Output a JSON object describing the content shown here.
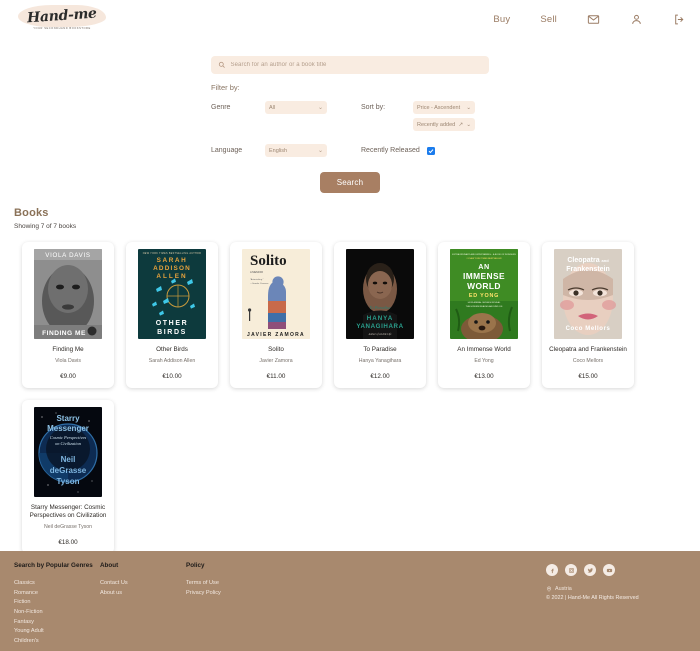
{
  "header": {
    "logo_word": "Hand-me",
    "logo_sub": "YOUR SECONDHAND BOOKSTORE",
    "nav": [
      {
        "label": "Buy",
        "name": "nav-buy"
      },
      {
        "label": "Sell",
        "name": "nav-sell"
      }
    ],
    "icons": [
      {
        "name": "mail-icon"
      },
      {
        "name": "user-icon"
      },
      {
        "name": "logout-icon"
      }
    ],
    "accent": "#9a7b63"
  },
  "search": {
    "placeholder": "Search for an author or a book title",
    "value": "",
    "icon": "search-icon"
  },
  "filters": {
    "title": "Filter by:",
    "genre_label": "Genre",
    "genre_value": "All",
    "language_label": "Language",
    "language_value": "English",
    "sort_label": "Sort by:",
    "sort_price_value": "Price - Ascendent",
    "sort_recent_value": "Recently added",
    "sort_recent_direction": "↗",
    "recently_released_label": "Recently Released",
    "recently_released_checked": true,
    "caret": "⌄"
  },
  "search_button": {
    "label": "Search",
    "color": "#a87f63"
  },
  "books_section": {
    "title": "Books",
    "count_text": "Showing 7 of 7 books"
  },
  "books": [
    {
      "title": "Finding Me",
      "author": "Viola Davis",
      "price": "€9.00",
      "cover": {
        "style": "viola",
        "line1": "VIOLA DAVIS",
        "line2": "FINDING ME"
      }
    },
    {
      "title": "Other Birds",
      "author": "Sarah Addison Allen",
      "price": "€10.00",
      "cover": {
        "style": "otherbirds",
        "line1": "SARAH ADDISON ALLEN",
        "line2": "OTHER BIRDS"
      }
    },
    {
      "title": "Solito",
      "author": "Javier Zamora",
      "price": "€11.00",
      "cover": {
        "style": "solito",
        "line1": "Solito",
        "line2": "JAVIER ZAMORA"
      }
    },
    {
      "title": "To Paradise",
      "author": "Hanya Yanagihara",
      "price": "€12.00",
      "cover": {
        "style": "toparadise",
        "line1": "To Paradise",
        "line2": "HANYA YANAGIHARA"
      }
    },
    {
      "title": "An Immense World",
      "author": "Ed Yong",
      "price": "€13.00",
      "cover": {
        "style": "immense",
        "line1": "AN IMMENSE WORLD",
        "line2": "ED YONG"
      }
    },
    {
      "title": "Cleopatra and Frankenstein",
      "author": "Coco Mellors",
      "price": "€15.00",
      "cover": {
        "style": "cleopatra",
        "line1": "Cleopatra and Frankenstein",
        "line2": "Coco Mellors"
      }
    },
    {
      "title": "Starry Messenger: Cosmic Perspectives on Civilization",
      "author": "Neil deGrasse Tyson",
      "price": "€18.00",
      "cover": {
        "style": "starry",
        "line1": "Starry Messenger",
        "line2": "Neil deGrasse Tyson"
      }
    }
  ],
  "footer": {
    "background": "#a8896e",
    "col1_head": "Search by Popular Genres",
    "col1_links": [
      "Classics",
      "Romance",
      "Fiction",
      "Non-Fiction",
      "Fantasy",
      "Young Adult",
      "Children's"
    ],
    "col2_head": "About",
    "col2_links": [
      "Contact Us",
      "About us"
    ],
    "col3_head": "Policy",
    "col3_links": [
      "Terms of Use",
      "Privacy Policy"
    ],
    "socials": [
      "facebook-icon",
      "instagram-icon",
      "twitter-icon",
      "youtube-icon"
    ],
    "location": "Austria",
    "copyright": "© 2022 | Hand-Me All Rights Reserved"
  }
}
